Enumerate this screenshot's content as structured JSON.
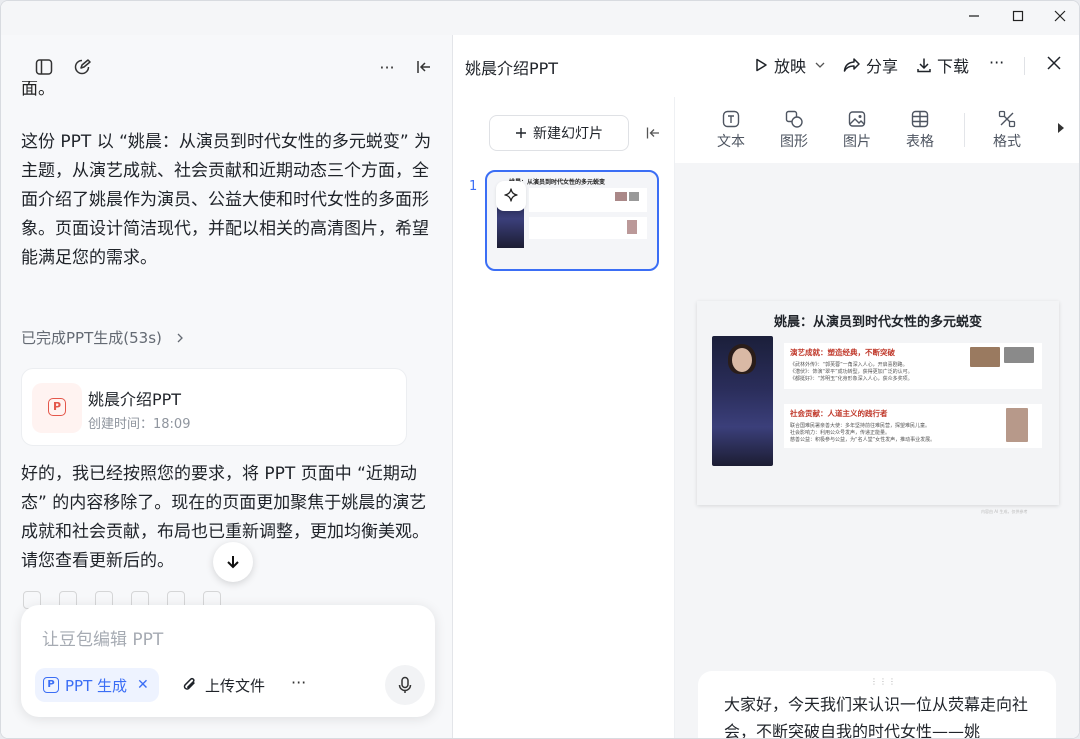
{
  "window": {
    "min": "—",
    "max": "☐",
    "close": "✕"
  },
  "chat": {
    "cut_text": "面。",
    "para1": "这份 PPT 以 “姚晨：从演员到时代女性的多元蜕变” 为主题，从演艺成就、社会贡献和近期动态三个方面，全面介绍了姚晨作为演员、公益大使和时代女性的多面形象。页面设计简洁现代，并配以相关的高清图片，希望能满足您的需求。",
    "done_label": "已完成PPT生成(53s)",
    "card": {
      "title": "姚晨介绍PPT",
      "time": "创建时间：18:09",
      "icon_letter": "P"
    },
    "para2": "好的，我已经按照您的要求，将 PPT 页面中 “近期动态” 的内容移除了。现在的页面更加聚焦于姚晨的演艺成就和社会贡献，布局也已重新调整，更加均衡美观。请您查看更新后的",
    "para2_tail": "。",
    "composer": {
      "placeholder": "让豆包编辑 PPT",
      "chip_label": "PPT 生成",
      "chip_letter": "P",
      "upload_label": "上传文件",
      "more": "···"
    }
  },
  "header": {
    "title": "姚晨介绍PPT",
    "play": "放映",
    "share": "分享",
    "download": "下载",
    "more": "···"
  },
  "thumbs": {
    "new_slide": "新建幻灯片",
    "slide_number": "1",
    "thumb_title": "姚晨：从演员到时代女性的多元蜕变"
  },
  "toolbar": {
    "text": "文本",
    "shape": "图形",
    "image": "图片",
    "table": "表格",
    "format": "格式"
  },
  "slide": {
    "title": "姚晨：从演员到时代女性的多元蜕变",
    "box1": {
      "heading": "演艺成就：塑造经典，不断突破",
      "lines": [
        "《武林外传》：“郭芙蓉”一角深入人心，开启喜剧路。",
        "《潜伏》：饰演“翠平”成功转型，获得更加广泛的认可。",
        "《都挺好》：“苏明玉”化身形象深入人心，获众多奖项。"
      ]
    },
    "box2": {
      "heading": "社会贡献：人道主义的践行者",
      "lines": [
        "联合国难民署亲善大使：多年坚持前往难民营，探望难民儿童。",
        "社会影响力：利用公众号发声，传递正能量。",
        "慈善公益：积极参与公益，为“名人堂”女性发声，推动事业发展。"
      ]
    },
    "footer": "内容由 AI 生成，仅供参考"
  },
  "notes": {
    "drag": "⋮⋮⋮",
    "text": "大家好，今天我们来认识一位从荧幕走向社会，不断突破自我的时代女性——姚"
  }
}
